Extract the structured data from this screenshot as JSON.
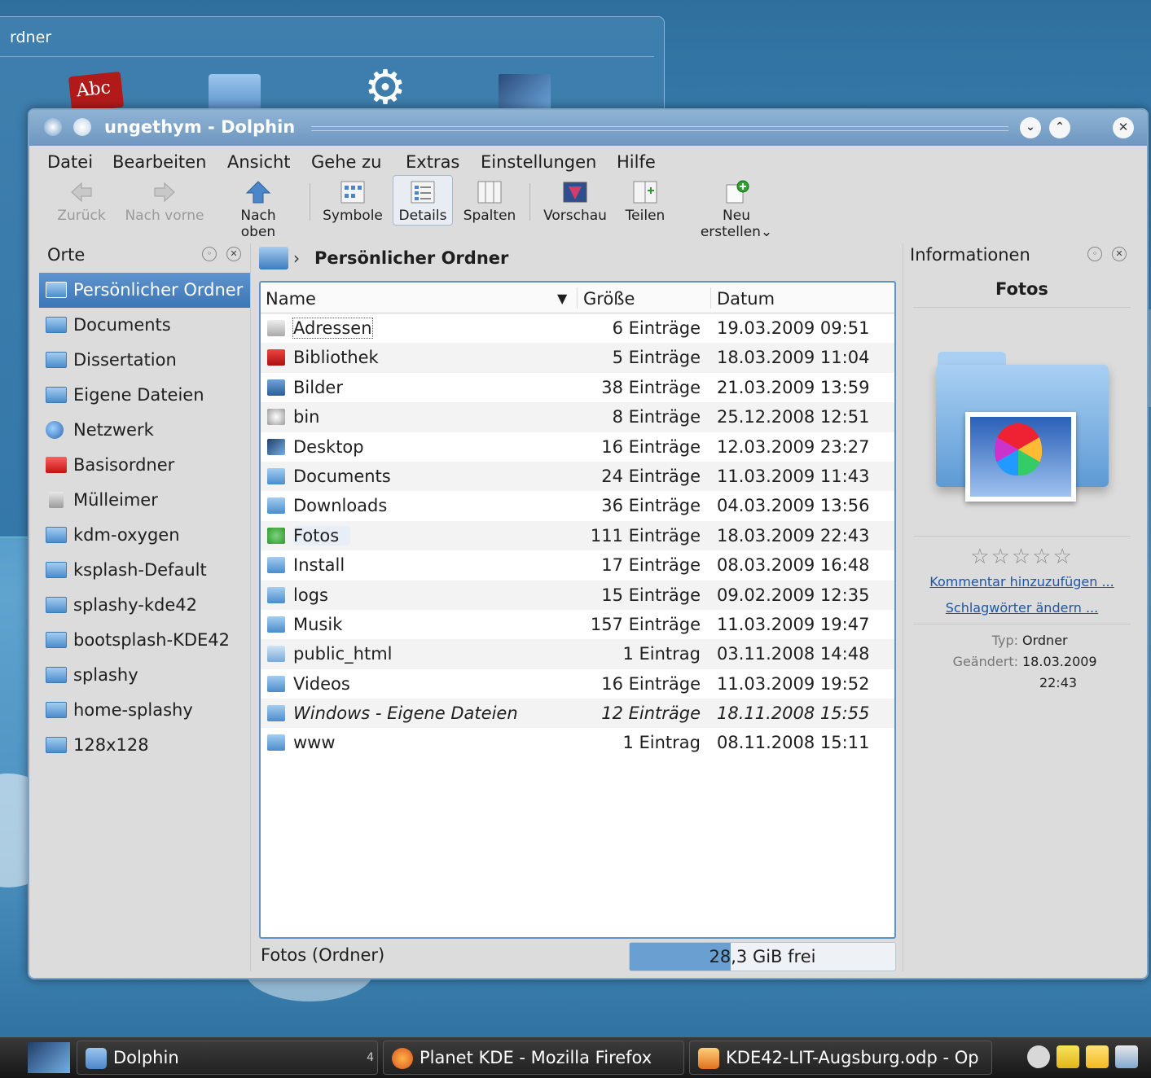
{
  "background_window": {
    "title": "rdner"
  },
  "window": {
    "title": "ungethym - Dolphin",
    "buttons": {
      "minimize": "⌄",
      "maximize": "⌃",
      "close": "✕"
    }
  },
  "menu": [
    "Datei",
    "Bearbeiten",
    "Ansicht",
    "Gehe zu",
    "Extras",
    "Einstellungen",
    "Hilfe"
  ],
  "toolbar": {
    "back": "Zurück",
    "forward": "Nach vorne",
    "up": "Nach oben",
    "icons": "Symbole",
    "details": "Details",
    "columns": "Spalten",
    "preview": "Vorschau",
    "split": "Teilen",
    "new": "Neu erstellen"
  },
  "places": {
    "title": "Orte",
    "items": [
      {
        "label": "Persönlicher Ordner",
        "icon": "home-icon",
        "selected": true
      },
      {
        "label": "Documents",
        "icon": "folder-icon"
      },
      {
        "label": "Dissertation",
        "icon": "folder-icon"
      },
      {
        "label": "Eigene Dateien",
        "icon": "folder-icon"
      },
      {
        "label": "Netzwerk",
        "icon": "network-icon"
      },
      {
        "label": "Basisordner",
        "icon": "root-folder-icon"
      },
      {
        "label": "Mülleimer",
        "icon": "trash-icon"
      },
      {
        "label": "kdm-oxygen",
        "icon": "folder-icon"
      },
      {
        "label": "ksplash-Default",
        "icon": "folder-icon"
      },
      {
        "label": "splashy-kde42",
        "icon": "folder-icon"
      },
      {
        "label": "bootsplash-KDE42",
        "icon": "folder-icon"
      },
      {
        "label": "splashy",
        "icon": "folder-icon"
      },
      {
        "label": "home-splashy",
        "icon": "folder-icon"
      },
      {
        "label": "128x128",
        "icon": "folder-icon"
      }
    ]
  },
  "breadcrumb": {
    "current": "Persönlicher Ordner"
  },
  "columns": {
    "name": "Name",
    "size": "Größe",
    "date": "Datum"
  },
  "files": [
    {
      "name": "Adressen",
      "size": "6 Einträge",
      "date": "19.03.2009 09:51",
      "icon": "address-book-icon"
    },
    {
      "name": "Bibliothek",
      "size": "5 Einträge",
      "date": "18.03.2009 11:04",
      "icon": "library-icon"
    },
    {
      "name": "Bilder",
      "size": "38 Einträge",
      "date": "21.03.2009 13:59",
      "icon": "pictures-folder-icon"
    },
    {
      "name": "bin",
      "size": "8 Einträge",
      "date": "25.12.2008 12:51",
      "icon": "gear-icon"
    },
    {
      "name": "Desktop",
      "size": "16 Einträge",
      "date": "12.03.2009 23:27",
      "icon": "desktop-folder-icon"
    },
    {
      "name": "Documents",
      "size": "24 Einträge",
      "date": "11.03.2009 11:43",
      "icon": "documents-folder-icon"
    },
    {
      "name": "Downloads",
      "size": "36 Einträge",
      "date": "04.03.2009 13:56",
      "icon": "downloads-folder-icon"
    },
    {
      "name": "Fotos",
      "size": "111 Einträge",
      "date": "18.03.2009 22:43",
      "icon": "photos-folder-icon"
    },
    {
      "name": "Install",
      "size": "17 Einträge",
      "date": "08.03.2009 16:48",
      "icon": "install-folder-icon"
    },
    {
      "name": "logs",
      "size": "15 Einträge",
      "date": "09.02.2009 12:35",
      "icon": "folder-icon"
    },
    {
      "name": "Musik",
      "size": "157 Einträge",
      "date": "11.03.2009 19:47",
      "icon": "music-folder-icon"
    },
    {
      "name": "public_html",
      "size": "1 Eintrag",
      "date": "03.11.2008 14:48",
      "icon": "html-folder-icon"
    },
    {
      "name": "Videos",
      "size": "16 Einträge",
      "date": "11.03.2009 19:52",
      "icon": "video-folder-icon"
    },
    {
      "name": "Windows - Eigene Dateien",
      "size": "12 Einträge",
      "date": "18.11.2008 15:55",
      "icon": "link-folder-icon"
    },
    {
      "name": "www",
      "size": "1 Eintrag",
      "date": "08.11.2008 15:11",
      "icon": "web-folder-icon"
    }
  ],
  "status": {
    "text": "Fotos (Ordner)",
    "free": "28,3 GiB frei",
    "used_fraction": 0.38
  },
  "info": {
    "title": "Informationen",
    "name": "Fotos",
    "stars": "☆☆☆☆☆",
    "comment_link": "Kommentar hinzuzufügen ...",
    "tags_link": "Schlagwörter ändern ...",
    "type_key": "Typ:",
    "type_val": "Ordner",
    "modified_key": "Geändert:",
    "modified_date": "18.03.2009",
    "modified_time": "22:43"
  },
  "taskbar": {
    "tasks": [
      {
        "label": "Dolphin",
        "count": "4"
      },
      {
        "label": "Planet KDE - Mozilla Firefox"
      },
      {
        "label": "KDE42-LIT-Augsburg.odp - Op"
      }
    ]
  },
  "colors": {
    "accent": "#5f93c6",
    "selection": "#3d76b5",
    "titlebar": "#7aa2c8"
  }
}
